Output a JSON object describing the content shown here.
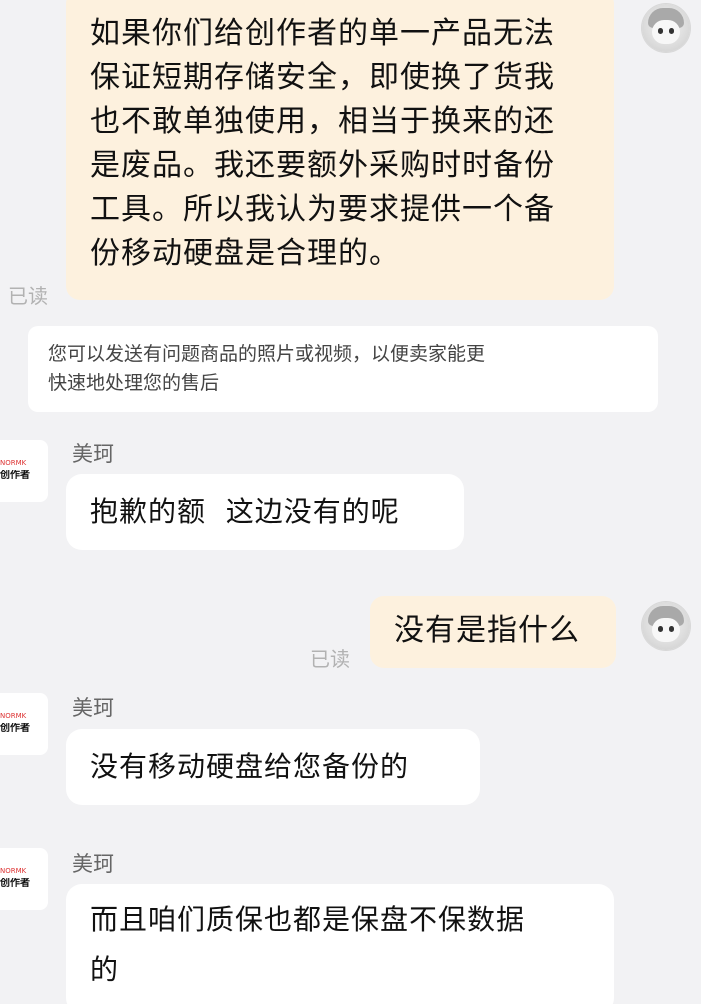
{
  "messages": {
    "m1": {
      "lines": [
        "如果你们给创作者的单一产品无法",
        "保证短期存储安全，即使换了货我",
        "也不敢单独使用，相当于换来的还",
        "是废品。我还要额外采购时时备份",
        "工具。所以我认为要求提供一个备",
        "份移动硬盘是合理的。"
      ],
      "read": "已读"
    },
    "notice": {
      "lines": [
        "您可以发送有问题商品的照片或视频，以便卖家能更",
        "快速地处理您的售后"
      ]
    },
    "m2": {
      "sender": "美珂",
      "text": "抱歉的额  这边没有的呢"
    },
    "m3": {
      "text": "没有是指什么",
      "read": "已读"
    },
    "m4": {
      "sender": "美珂",
      "text": "没有移动硬盘给您备份的"
    },
    "m5": {
      "sender": "美珂",
      "lines": [
        "而且咱们质保也都是保盘不保数据",
        "的"
      ]
    }
  },
  "seller_logo": {
    "small": "NORMK",
    "main": "创作者"
  }
}
